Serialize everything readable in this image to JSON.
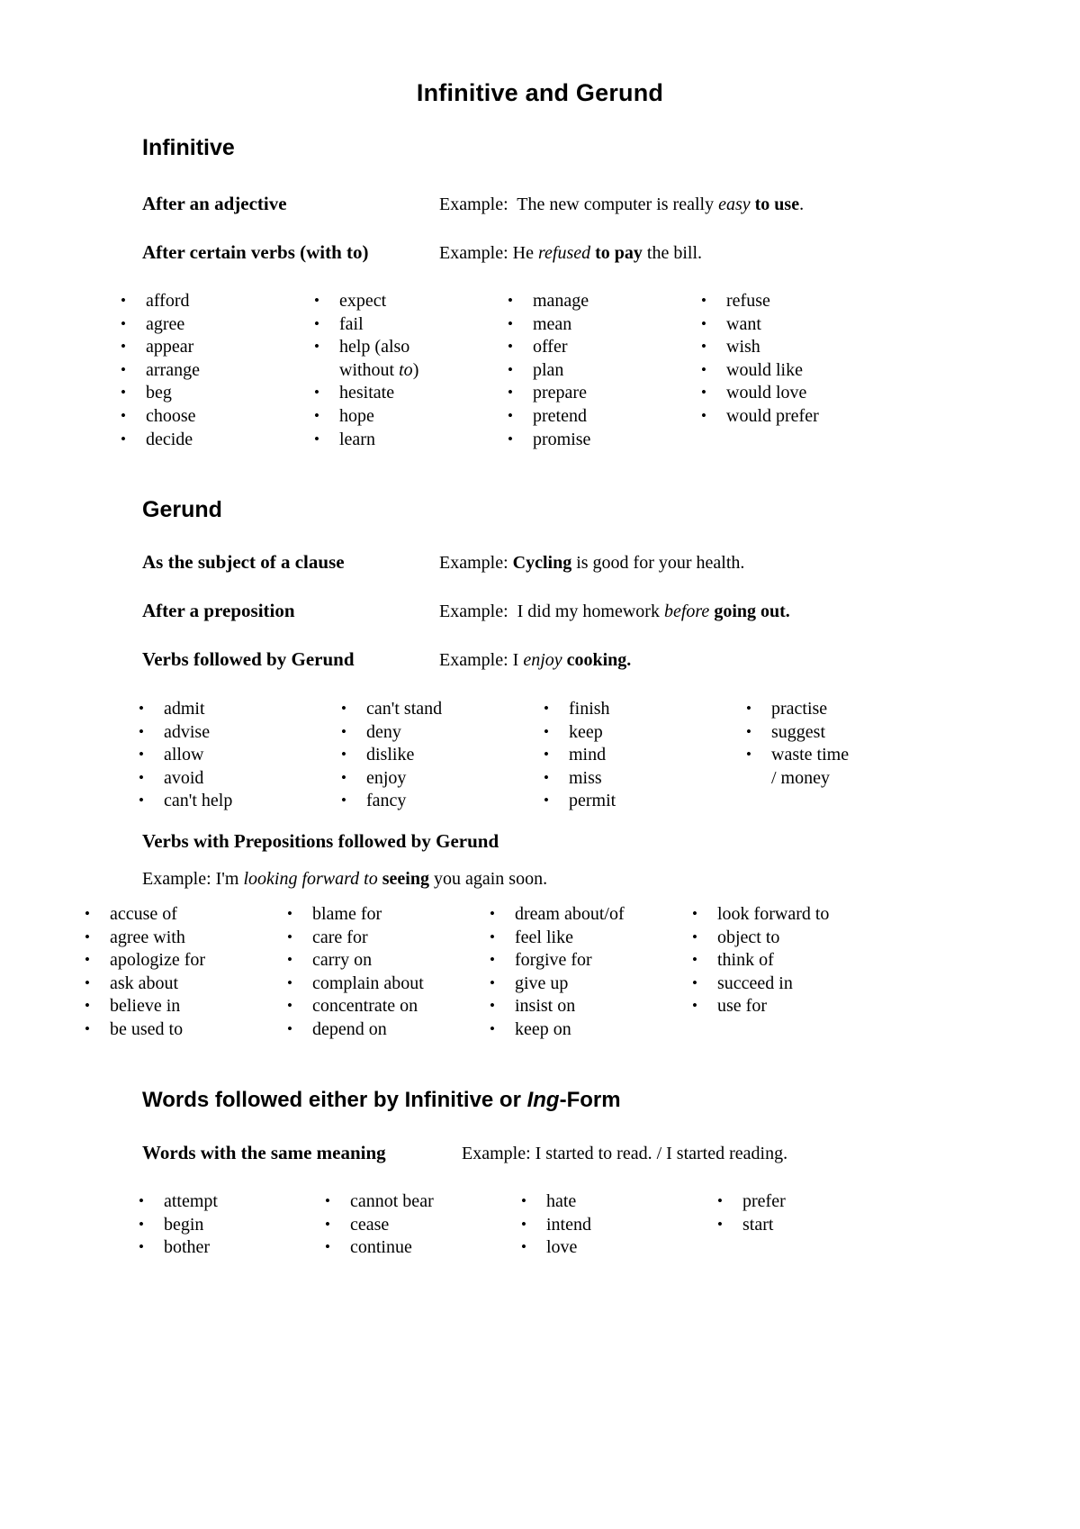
{
  "document": {
    "title": "Infinitive and Gerund"
  },
  "sections": {
    "infinitive": {
      "heading": "Infinitive",
      "rows": [
        {
          "label": "After an adjective",
          "example_prefix": "Example:  The new computer is really ",
          "example_italic": "easy",
          "example_mid": " ",
          "example_bold": "to use",
          "example_suffix": "."
        },
        {
          "label": "After certain verbs (with to)",
          "example_prefix": "Example: He ",
          "example_italic": "refused",
          "example_mid": " ",
          "example_bold": "to pay",
          "example_suffix": " the bill."
        }
      ],
      "columns": [
        {
          "items": [
            "afford",
            "agree",
            "appear",
            "arrange",
            "beg",
            "choose",
            "decide"
          ]
        },
        {
          "items": [
            "expect",
            "fail",
            "help (also",
            "without to)",
            "hesitate",
            "hope",
            "learn"
          ]
        },
        {
          "items": [
            "manage",
            "mean",
            "offer",
            "plan",
            "prepare",
            "pretend",
            "promise"
          ]
        },
        {
          "items": [
            "refuse",
            "want",
            "wish",
            "would like",
            "would love",
            "would prefer"
          ]
        }
      ]
    },
    "gerund": {
      "heading": "Gerund",
      "rows": [
        {
          "label": "As the subject of a clause",
          "example_prefix": "Example: ",
          "example_bold": "Cycling",
          "example_suffix": " is good for your health."
        },
        {
          "label": "After a preposition",
          "example_prefix": "Example:  I did my homework ",
          "example_italic": "before",
          "example_mid": " ",
          "example_bold": "going out.",
          "example_suffix": ""
        },
        {
          "label": "Verbs followed by Gerund",
          "example_prefix": "Example: I ",
          "example_italic": "enjoy",
          "example_mid": " ",
          "example_bold": "cooking.",
          "example_suffix": ""
        }
      ],
      "columns": [
        {
          "items": [
            "admit",
            "advise",
            "allow",
            "avoid",
            "can't help"
          ]
        },
        {
          "items": [
            "can't stand",
            "deny",
            "dislike",
            "enjoy",
            "fancy"
          ]
        },
        {
          "items": [
            "finish",
            "keep",
            "mind",
            "miss",
            "permit"
          ]
        },
        {
          "items": [
            "practise",
            "suggest",
            "waste time",
            "/ money"
          ]
        }
      ]
    },
    "verbs_prepositions": {
      "heading": "Verbs with Prepositions followed by Gerund",
      "example_prefix": "Example: I'm ",
      "example_italic": "looking forward to",
      "example_mid": " ",
      "example_bold": "seeing",
      "example_suffix": " you again soon.",
      "columns": [
        {
          "items": [
            "accuse of",
            "agree with",
            "apologize for",
            "ask about",
            "believe in",
            "be used to"
          ]
        },
        {
          "items": [
            "blame for",
            "care for",
            "carry on",
            "complain about",
            "concentrate on",
            "depend on"
          ]
        },
        {
          "items": [
            "dream about/of",
            "feel like",
            "forgive for",
            "give up",
            "insist on",
            "keep on"
          ]
        },
        {
          "items": [
            "look forward to",
            "object to",
            "think of",
            "succeed in",
            "use for"
          ]
        }
      ]
    },
    "either": {
      "heading_part1": "Words followed either by Infinitive or ",
      "heading_italic": "Ing",
      "heading_part2": "-Form",
      "row": {
        "label": "Words with the same meaning",
        "example": "Example: I started to read. / I started reading."
      },
      "columns": [
        {
          "items": [
            "attempt",
            "begin",
            "bother"
          ]
        },
        {
          "items": [
            "cannot bear",
            "cease",
            "continue"
          ]
        },
        {
          "items": [
            "hate",
            "intend",
            "love"
          ]
        },
        {
          "items": [
            "prefer",
            "start"
          ]
        }
      ]
    }
  }
}
